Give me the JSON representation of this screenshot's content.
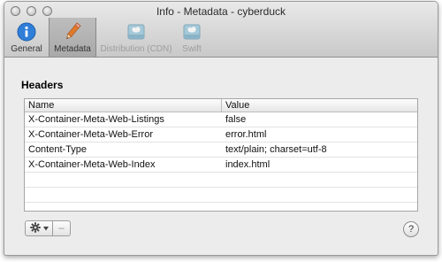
{
  "window": {
    "title": "Info - Metadata - cyberduck"
  },
  "toolbar": {
    "items": [
      {
        "label": "General",
        "icon": "info-icon",
        "state": "normal"
      },
      {
        "label": "Metadata",
        "icon": "pencil-icon",
        "state": "selected"
      },
      {
        "label": "Distribution (CDN)",
        "icon": "cloud-drive-icon",
        "state": "disabled"
      },
      {
        "label": "Swift",
        "icon": "cloud-drive-icon",
        "state": "disabled"
      }
    ]
  },
  "headers": {
    "title": "Headers",
    "columns": [
      "Name",
      "Value"
    ],
    "rows": [
      {
        "name": "X-Container-Meta-Web-Listings",
        "value": "false"
      },
      {
        "name": "X-Container-Meta-Web-Error",
        "value": "error.html"
      },
      {
        "name": "Content-Type",
        "value": "text/plain; charset=utf-8"
      },
      {
        "name": "X-Container-Meta-Web-Index",
        "value": "index.html"
      }
    ]
  },
  "actions": {
    "minus_label": "–",
    "help_label": "?"
  },
  "colors": {
    "accent_blue": "#2f7ed8",
    "pencil_orange": "#e07a2b"
  }
}
